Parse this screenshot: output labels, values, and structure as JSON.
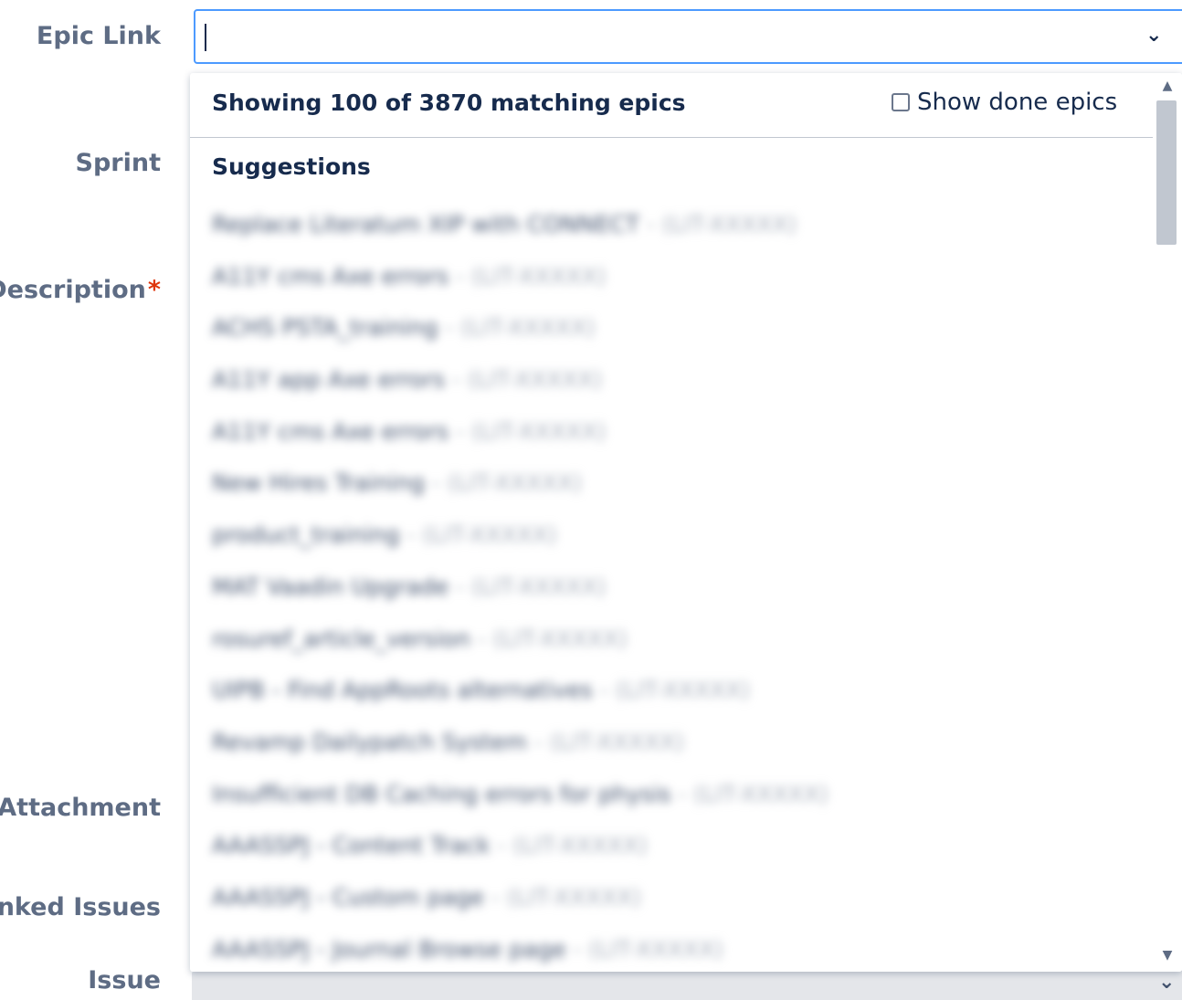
{
  "form": {
    "labels": {
      "epic_link": "Epic Link",
      "sprint": "Sprint",
      "description": "Description",
      "required_marker": "*",
      "attachment": "Attachment",
      "linked_issues": "Linked Issues",
      "issue": "Issue"
    },
    "epic_input": {
      "value": "",
      "dropdown_icon": "chevron-down-icon"
    },
    "issue_field": {
      "dropdown_icon": "chevron-down-icon"
    }
  },
  "dropdown": {
    "matching_summary": "Showing 100 of 3870 matching epics",
    "show_done_label": "Show done epics",
    "show_done_checked": false,
    "section_heading": "Suggestions",
    "items_note": "Suggestion items are blurred in the screenshot",
    "items": [
      {
        "name": "Replace Literatum XIP with CONNECT",
        "key": "(LIT-XXXXX)"
      },
      {
        "name": "A11Y cms Axe errors",
        "key": "(LIT-XXXXX)"
      },
      {
        "name": "ACHS PSTA_training",
        "key": "(LIT-XXXXX)"
      },
      {
        "name": "A11Y app Axe errors",
        "key": "(LIT-XXXXX)"
      },
      {
        "name": "A11Y cms Axe errors",
        "key": "(LIT-XXXXX)"
      },
      {
        "name": "New Hires Training",
        "key": "(LIT-XXXXX)"
      },
      {
        "name": "product_training",
        "key": "(LIT-XXXXX)"
      },
      {
        "name": "MAT Vaadin Upgrade",
        "key": "(LIT-XXXXX)"
      },
      {
        "name": "rosuref_article_version",
        "key": "(LIT-XXXXX)"
      },
      {
        "name": "UIPB - Find AppRoots alternatives",
        "key": "(LIT-XXXXX)"
      },
      {
        "name": "Revamp Dailypatch System",
        "key": "(LIT-XXXXX)"
      },
      {
        "name": "Insufficient DB Caching errors for physis",
        "key": "(LIT-XXXXX)"
      },
      {
        "name": "AAASSPJ - Content Track",
        "key": "(LIT-XXXXX)"
      },
      {
        "name": "AAASSPJ - Custom page",
        "key": "(LIT-XXXXX)"
      },
      {
        "name": "AAASSPJ - Journal Browse page",
        "key": "(LIT-XXXXX)"
      }
    ]
  },
  "scrollbar": {
    "up_icon": "triangle-up-icon",
    "down_icon": "triangle-down-icon",
    "scroll_position": 0.0
  },
  "colors": {
    "focus_border": "#4c9aff",
    "label_text": "#5e6c84",
    "heading_text": "#172b4d",
    "required": "#de350b"
  }
}
